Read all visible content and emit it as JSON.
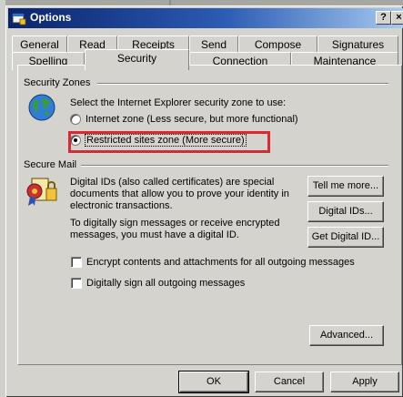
{
  "window": {
    "title": "Options",
    "help_glyph": "?",
    "close_glyph": "×"
  },
  "tabs_row1": [
    "General",
    "Read",
    "Receipts",
    "Send",
    "Compose",
    "Signatures"
  ],
  "tabs_row2": [
    "Spelling",
    "Security",
    "Connection",
    "Maintenance"
  ],
  "active_tab": "Security",
  "security_zones": {
    "heading": "Security Zones",
    "prompt": "Select the Internet Explorer security zone to use:",
    "options": [
      {
        "label": "Internet zone (Less secure, but more functional)",
        "checked": false
      },
      {
        "label": "Restricted sites zone (More secure)",
        "checked": true
      }
    ]
  },
  "secure_mail": {
    "heading": "Secure Mail",
    "para1": [
      "Digital IDs (also called certificates) are special",
      "documents that allow you to prove your identity in",
      "electronic transactions."
    ],
    "para2": [
      "To digitally sign messages or receive encrypted",
      "messages, you must have a digital ID."
    ],
    "buttons": {
      "tell_me_more": "Tell me more...",
      "digital_ids": "Digital IDs...",
      "get_digital_id": "Get Digital ID..."
    },
    "checkboxes": [
      {
        "label": "Encrypt contents and attachments for all outgoing messages",
        "checked": false
      },
      {
        "label": "Digitally sign all outgoing messages",
        "checked": false
      }
    ]
  },
  "advanced_button": "Advanced...",
  "footer_buttons": {
    "ok": "OK",
    "cancel": "Cancel",
    "apply": "Apply"
  },
  "colors": {
    "highlight_box": "#d62b35",
    "title_bar": "#0a246a",
    "dialog_face": "#d5d3ce"
  }
}
